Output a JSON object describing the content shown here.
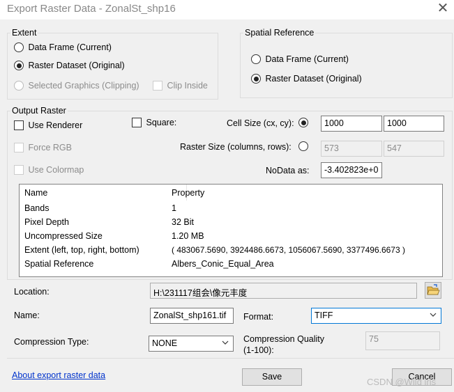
{
  "window": {
    "title": "Export Raster Data - ZonalSt_shp16"
  },
  "extent": {
    "legend": "Extent",
    "data_frame": "Data Frame (Current)",
    "raster_dataset": "Raster Dataset (Original)",
    "selected_graphics": "Selected Graphics (Clipping)",
    "clip_inside": "Clip Inside"
  },
  "spatial_reference": {
    "legend": "Spatial Reference",
    "data_frame": "Data Frame (Current)",
    "raster_dataset": "Raster Dataset (Original)"
  },
  "output_raster": {
    "legend": "Output Raster",
    "use_renderer": "Use Renderer",
    "square": "Square:",
    "cell_size_label": "Cell Size (cx, cy):",
    "cell_cx": "1000",
    "cell_cy": "1000",
    "force_rgb": "Force RGB",
    "raster_size_label": "Raster Size (columns, rows):",
    "columns": "573",
    "rows": "547",
    "use_colormap": "Use Colormap",
    "nodata_label": "NoData as:",
    "nodata_value": "-3.402823e+0"
  },
  "properties": {
    "headers": {
      "name": "Name",
      "property": "Property"
    },
    "rows": [
      {
        "name": "Bands",
        "value": "1"
      },
      {
        "name": "Pixel Depth",
        "value": "32 Bit"
      },
      {
        "name": "Uncompressed Size",
        "value": "1.20 MB"
      },
      {
        "name": "Extent (left, top, right, bottom)",
        "value": "( 483067.5690, 3924486.6673, 1056067.5690, 3377496.6673 )"
      },
      {
        "name": "Spatial Reference",
        "value": "Albers_Conic_Equal_Area"
      }
    ]
  },
  "location": {
    "label": "Location:",
    "value": "H:\\231117组会\\像元丰度"
  },
  "name": {
    "label": "Name:",
    "value": "ZonalSt_shp161.tif"
  },
  "format": {
    "label": "Format:",
    "value": "TIFF"
  },
  "compression": {
    "type_label": "Compression Type:",
    "type_value": "NONE",
    "quality_label_1": "Compression Quality",
    "quality_label_2": "(1-100):",
    "quality_value": "75"
  },
  "footer": {
    "about_link": "About export raster data",
    "save": "Save",
    "cancel": "Cancel",
    "watermark": "CSDN @Wild iris"
  },
  "colors": {
    "accent": "#0078d7",
    "link": "#0033cc",
    "dialog_bg": "#f0f0f0"
  }
}
